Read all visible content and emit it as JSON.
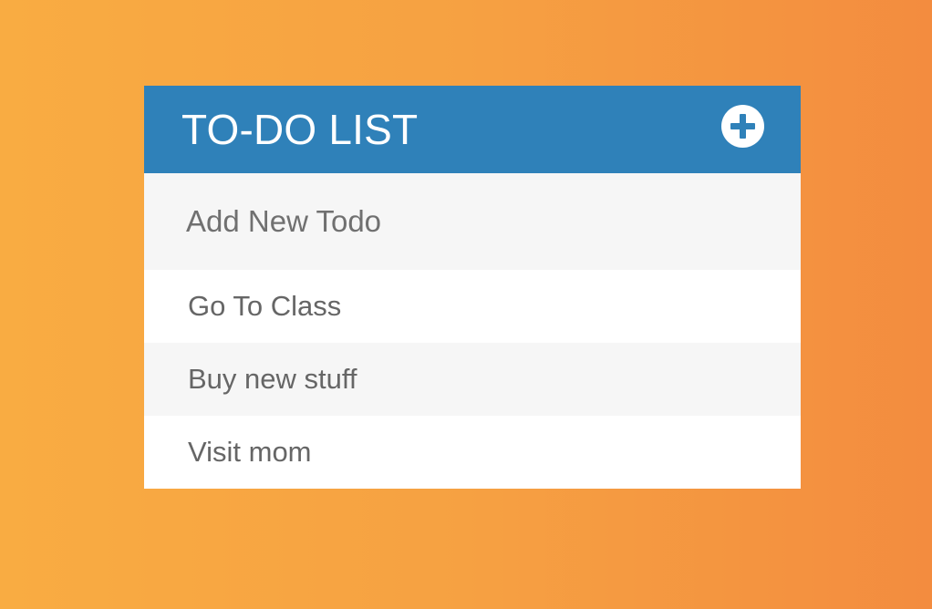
{
  "header": {
    "title": "TO-DO LIST",
    "add_icon": "plus-circle-icon"
  },
  "new_todo": {
    "placeholder": "Add New Todo",
    "value": ""
  },
  "todos": [
    {
      "text": "Go To Class"
    },
    {
      "text": "Buy new stuff"
    },
    {
      "text": "Visit mom"
    }
  ],
  "colors": {
    "background_gradient_start": "#f9ac42",
    "background_gradient_end": "#f38c3f",
    "header": "#2f81b9",
    "input_background": "#f6f6f6",
    "item_alt_background": "#f6f6f6",
    "text": "#666666"
  }
}
